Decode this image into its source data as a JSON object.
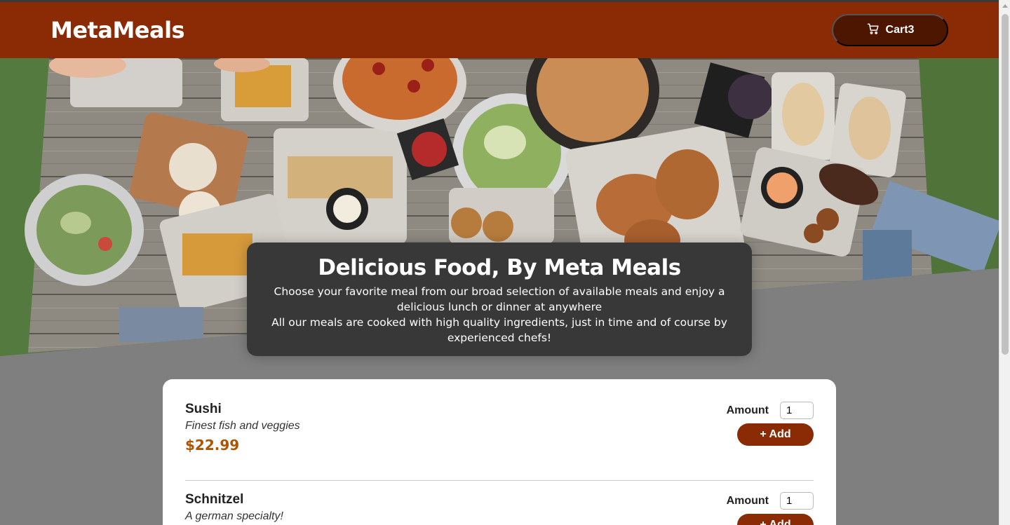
{
  "app": {
    "brand": "MetaMeals"
  },
  "header": {
    "cart_icon": "shopping-cart-icon",
    "cart_label": "Cart",
    "cart_count": "3"
  },
  "summary": {
    "title": "Delicious Food, By Meta Meals",
    "paragraph1": "Choose your favorite meal from our broad selection of available meals and enjoy a delicious lunch or dinner at anywhere",
    "paragraph2": "All our meals are cooked with high quality ingredients, just in time and of course by experienced chefs!"
  },
  "meals": [
    {
      "name": "Sushi",
      "description": "Finest fish and veggies",
      "price": "$22.99",
      "amount_label": "Amount",
      "amount_value": "1",
      "add_label": "+ Add"
    },
    {
      "name": "Schnitzel",
      "description": "A german specialty!",
      "price": "",
      "amount_label": "Amount",
      "amount_value": "1",
      "add_label": "+ Add"
    }
  ],
  "colors": {
    "header": "#8a2b06",
    "cart_button": "#4d1601",
    "price": "#ad5502",
    "background": "#7f7f7f",
    "summary": "#383838"
  }
}
